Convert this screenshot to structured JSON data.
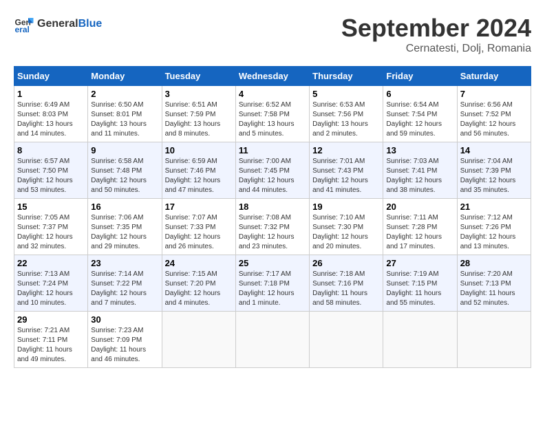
{
  "header": {
    "logo_general": "General",
    "logo_blue": "Blue",
    "month_title": "September 2024",
    "location": "Cernatesti, Dolj, Romania"
  },
  "weekdays": [
    "Sunday",
    "Monday",
    "Tuesday",
    "Wednesday",
    "Thursday",
    "Friday",
    "Saturday"
  ],
  "weeks": [
    [
      {
        "day": "1",
        "sunrise": "6:49 AM",
        "sunset": "8:03 PM",
        "daylight": "13 hours and 14 minutes."
      },
      {
        "day": "2",
        "sunrise": "6:50 AM",
        "sunset": "8:01 PM",
        "daylight": "13 hours and 11 minutes."
      },
      {
        "day": "3",
        "sunrise": "6:51 AM",
        "sunset": "7:59 PM",
        "daylight": "13 hours and 8 minutes."
      },
      {
        "day": "4",
        "sunrise": "6:52 AM",
        "sunset": "7:58 PM",
        "daylight": "13 hours and 5 minutes."
      },
      {
        "day": "5",
        "sunrise": "6:53 AM",
        "sunset": "7:56 PM",
        "daylight": "13 hours and 2 minutes."
      },
      {
        "day": "6",
        "sunrise": "6:54 AM",
        "sunset": "7:54 PM",
        "daylight": "12 hours and 59 minutes."
      },
      {
        "day": "7",
        "sunrise": "6:56 AM",
        "sunset": "7:52 PM",
        "daylight": "12 hours and 56 minutes."
      }
    ],
    [
      {
        "day": "8",
        "sunrise": "6:57 AM",
        "sunset": "7:50 PM",
        "daylight": "12 hours and 53 minutes."
      },
      {
        "day": "9",
        "sunrise": "6:58 AM",
        "sunset": "7:48 PM",
        "daylight": "12 hours and 50 minutes."
      },
      {
        "day": "10",
        "sunrise": "6:59 AM",
        "sunset": "7:46 PM",
        "daylight": "12 hours and 47 minutes."
      },
      {
        "day": "11",
        "sunrise": "7:00 AM",
        "sunset": "7:45 PM",
        "daylight": "12 hours and 44 minutes."
      },
      {
        "day": "12",
        "sunrise": "7:01 AM",
        "sunset": "7:43 PM",
        "daylight": "12 hours and 41 minutes."
      },
      {
        "day": "13",
        "sunrise": "7:03 AM",
        "sunset": "7:41 PM",
        "daylight": "12 hours and 38 minutes."
      },
      {
        "day": "14",
        "sunrise": "7:04 AM",
        "sunset": "7:39 PM",
        "daylight": "12 hours and 35 minutes."
      }
    ],
    [
      {
        "day": "15",
        "sunrise": "7:05 AM",
        "sunset": "7:37 PM",
        "daylight": "12 hours and 32 minutes."
      },
      {
        "day": "16",
        "sunrise": "7:06 AM",
        "sunset": "7:35 PM",
        "daylight": "12 hours and 29 minutes."
      },
      {
        "day": "17",
        "sunrise": "7:07 AM",
        "sunset": "7:33 PM",
        "daylight": "12 hours and 26 minutes."
      },
      {
        "day": "18",
        "sunrise": "7:08 AM",
        "sunset": "7:32 PM",
        "daylight": "12 hours and 23 minutes."
      },
      {
        "day": "19",
        "sunrise": "7:10 AM",
        "sunset": "7:30 PM",
        "daylight": "12 hours and 20 minutes."
      },
      {
        "day": "20",
        "sunrise": "7:11 AM",
        "sunset": "7:28 PM",
        "daylight": "12 hours and 17 minutes."
      },
      {
        "day": "21",
        "sunrise": "7:12 AM",
        "sunset": "7:26 PM",
        "daylight": "12 hours and 13 minutes."
      }
    ],
    [
      {
        "day": "22",
        "sunrise": "7:13 AM",
        "sunset": "7:24 PM",
        "daylight": "12 hours and 10 minutes."
      },
      {
        "day": "23",
        "sunrise": "7:14 AM",
        "sunset": "7:22 PM",
        "daylight": "12 hours and 7 minutes."
      },
      {
        "day": "24",
        "sunrise": "7:15 AM",
        "sunset": "7:20 PM",
        "daylight": "12 hours and 4 minutes."
      },
      {
        "day": "25",
        "sunrise": "7:17 AM",
        "sunset": "7:18 PM",
        "daylight": "12 hours and 1 minute."
      },
      {
        "day": "26",
        "sunrise": "7:18 AM",
        "sunset": "7:16 PM",
        "daylight": "11 hours and 58 minutes."
      },
      {
        "day": "27",
        "sunrise": "7:19 AM",
        "sunset": "7:15 PM",
        "daylight": "11 hours and 55 minutes."
      },
      {
        "day": "28",
        "sunrise": "7:20 AM",
        "sunset": "7:13 PM",
        "daylight": "11 hours and 52 minutes."
      }
    ],
    [
      {
        "day": "29",
        "sunrise": "7:21 AM",
        "sunset": "7:11 PM",
        "daylight": "11 hours and 49 minutes."
      },
      {
        "day": "30",
        "sunrise": "7:23 AM",
        "sunset": "7:09 PM",
        "daylight": "11 hours and 46 minutes."
      },
      null,
      null,
      null,
      null,
      null
    ]
  ]
}
